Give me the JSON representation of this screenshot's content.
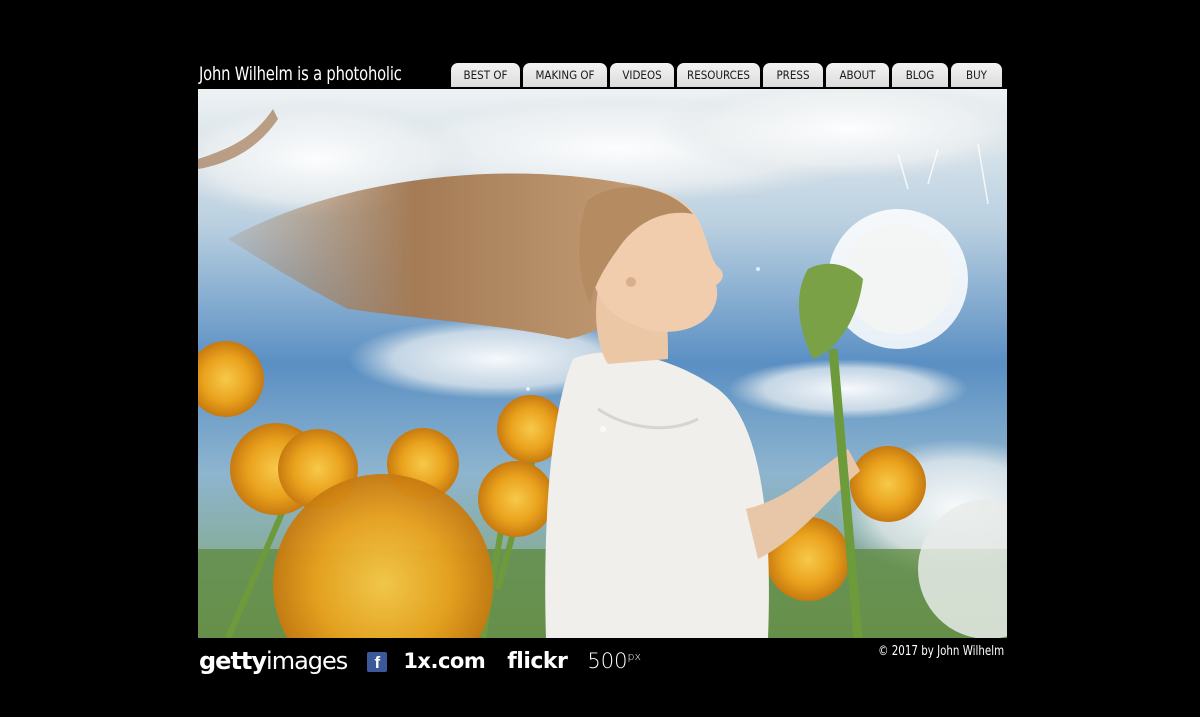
{
  "site": {
    "title": "John Wilhelm is a photoholic"
  },
  "nav": {
    "items": [
      {
        "label": "BEST OF"
      },
      {
        "label": "MAKING OF"
      },
      {
        "label": "VIDEOS"
      },
      {
        "label": "RESOURCES"
      },
      {
        "label": "PRESS"
      },
      {
        "label": "ABOUT"
      },
      {
        "label": "BLOG"
      },
      {
        "label": "BUY"
      }
    ]
  },
  "hero": {
    "subject": "girl blowing a dandelion in a field of yellow flowers"
  },
  "footer": {
    "logos": {
      "getty_main": "getty",
      "getty_sub": "images",
      "facebook": "f",
      "onex": "1x.com",
      "flickr": "flickr",
      "fivehundred": "500",
      "fivehundred_sup": "px"
    },
    "copyright": "© 2017 by John Wilhelm"
  },
  "colors": {
    "background": "#000000",
    "nav_tab": "#e6e6e6",
    "facebook": "#3b5998"
  }
}
